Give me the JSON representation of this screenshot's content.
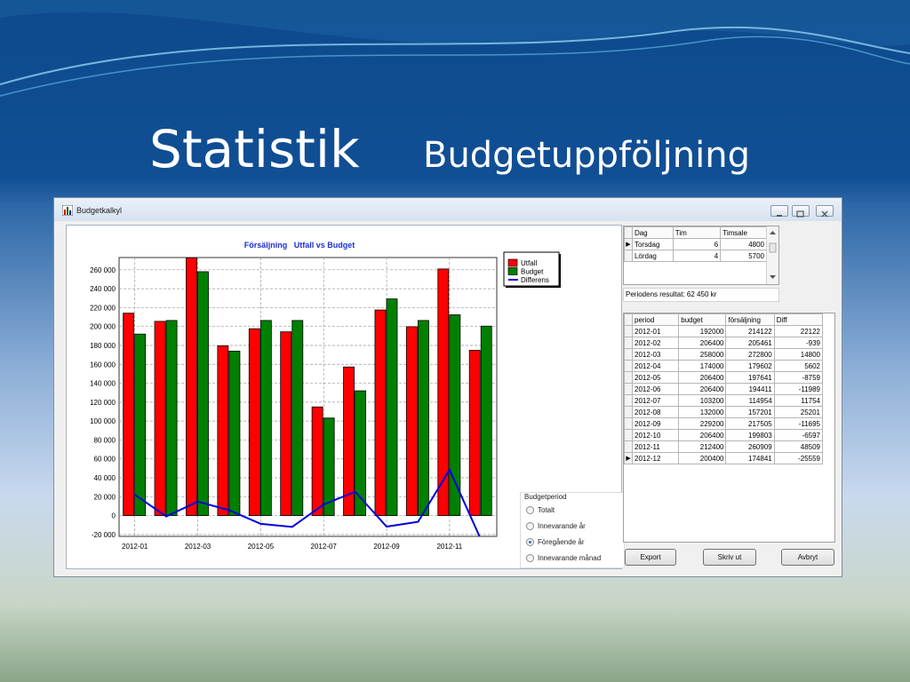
{
  "slide": {
    "title": "Statistik",
    "subtitle": "Budgetuppföljning"
  },
  "window": {
    "title": "Budgetkalkyl",
    "buttons": [
      "minimize",
      "maximize",
      "close"
    ]
  },
  "chart_data": {
    "type": "bar",
    "title": "Försäljning   Utfall vs Budget",
    "categories": [
      "2012-01",
      "2012-02",
      "2012-03",
      "2012-04",
      "2012-05",
      "2012-06",
      "2012-07",
      "2012-08",
      "2012-09",
      "2012-10",
      "2012-11",
      "2012-12"
    ],
    "x_tick_labels": [
      "2012-01",
      "2012-03",
      "2012-05",
      "2012-07",
      "2012-09",
      "2012-11"
    ],
    "y_tick_labels": [
      "260 000",
      "240 000",
      "220 000",
      "200 000",
      "180 000",
      "160 000",
      "140 000",
      "120 000",
      "100 000",
      "80 000",
      "60 000",
      "40 000",
      "20 000",
      "0",
      "-20 000"
    ],
    "ylim": [
      -22000,
      273000
    ],
    "series": [
      {
        "name": "Utfall",
        "color": "#ff0000",
        "values": [
          214122,
          205461,
          272800,
          179602,
          197641,
          194411,
          114954,
          157201,
          217505,
          199803,
          260909,
          174841
        ]
      },
      {
        "name": "Budget",
        "color": "#008000",
        "values": [
          192000,
          206400,
          258000,
          174000,
          206400,
          206400,
          103200,
          132000,
          229200,
          206400,
          212400,
          200400
        ]
      },
      {
        "name": "Differens",
        "color": "#0000dd",
        "type": "line",
        "values": [
          22122,
          -939,
          14800,
          5602,
          -8759,
          -11989,
          11754,
          25201,
          -11695,
          -6597,
          48509,
          -25559
        ]
      }
    ],
    "grid": true,
    "legend_position": "right"
  },
  "budget_period": {
    "title": "Budgetperiod",
    "options": [
      "Totalt",
      "Innevarande år",
      "Föregående år",
      "Innevarande månad"
    ],
    "selected": "Föregående år"
  },
  "day_table": {
    "columns": [
      "Dag",
      "Tim",
      "Timsale"
    ],
    "rows": [
      [
        "Torsdag",
        "6",
        "4800"
      ],
      [
        "Lördag",
        "4",
        "5700"
      ]
    ]
  },
  "period_result": "Periodens resultat:  62 450 kr",
  "period_table": {
    "columns": [
      "period",
      "budget",
      "försäljning",
      "Diff"
    ],
    "rows": [
      [
        "2012-01",
        "192000",
        "214122",
        "22122"
      ],
      [
        "2012-02",
        "206400",
        "205461",
        "-939"
      ],
      [
        "2012-03",
        "258000",
        "272800",
        "14800"
      ],
      [
        "2012-04",
        "174000",
        "179602",
        "5602"
      ],
      [
        "2012-05",
        "206400",
        "197641",
        "-8759"
      ],
      [
        "2012-06",
        "206400",
        "194411",
        "-11989"
      ],
      [
        "2012-07",
        "103200",
        "114954",
        "11754"
      ],
      [
        "2012-08",
        "132000",
        "157201",
        "25201"
      ],
      [
        "2012-09",
        "229200",
        "217505",
        "-11695"
      ],
      [
        "2012-10",
        "206400",
        "199803",
        "-6597"
      ],
      [
        "2012-11",
        "212400",
        "260909",
        "48509"
      ],
      [
        "2012-12",
        "200400",
        "174841",
        "-25559"
      ]
    ]
  },
  "buttons": {
    "export": "Export",
    "print": "Skriv ut",
    "cancel": "Avbryt"
  }
}
